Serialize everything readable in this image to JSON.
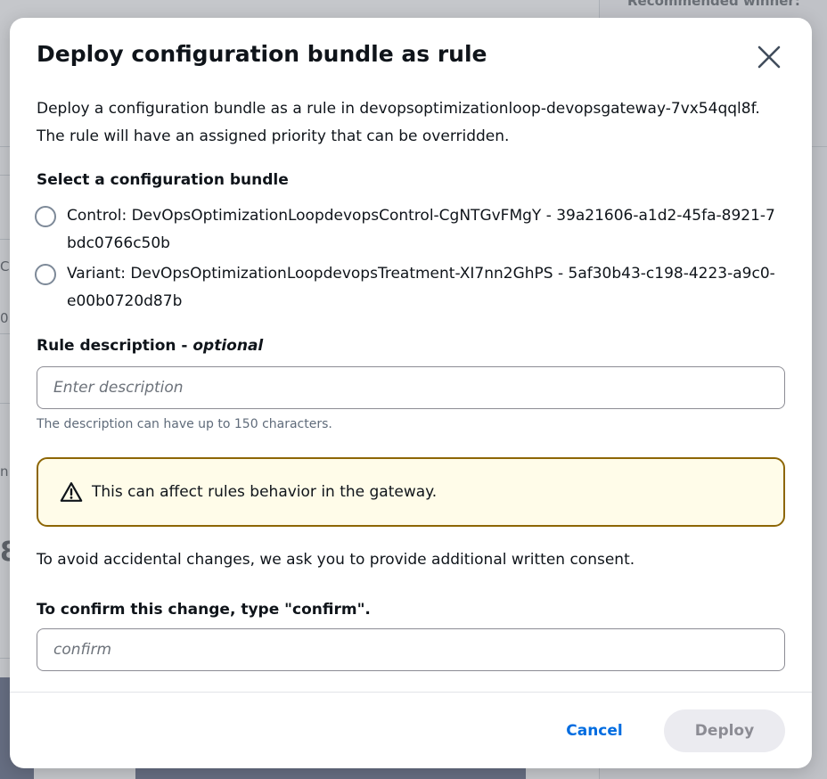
{
  "background": {
    "right_panel_heading": "Recommended winner:",
    "fragments": [
      "C",
      "0",
      "n",
      "8"
    ]
  },
  "modal": {
    "title": "Deploy configuration bundle as rule",
    "close_icon": "close-icon",
    "intro": "Deploy a configuration bundle as a rule in devopsoptimizationloop-devopsgateway-7vx54qql8f. The rule will have an assigned priority that can be overridden.",
    "bundle_section": {
      "label": "Select a configuration bundle",
      "options": [
        {
          "label": "Control: DevOpsOptimizationLoopdevopsControl-CgNTGvFMgY - 39a21606-a1d2-45fa-8921-7bdc0766c50b",
          "selected": false
        },
        {
          "label": "Variant: DevOpsOptimizationLoopdevopsTreatment-XI7nn2GhPS - 5af30b43-c198-4223-a9c0-e00b0720d87b",
          "selected": false
        }
      ]
    },
    "description": {
      "label": "Rule description - ",
      "label_optional": "optional",
      "placeholder": "Enter description",
      "value": "",
      "hint": "The description can have up to 150 characters."
    },
    "warning": {
      "icon": "warning-icon",
      "text": "This can affect rules behavior in the gateway.",
      "border_color": "#8d6605",
      "background_color": "#fffce9"
    },
    "consent_text": "To avoid accidental changes, we ask you to provide additional written consent.",
    "confirm": {
      "label": "To confirm this change, type \"confirm\".",
      "placeholder": "confirm",
      "value": ""
    },
    "buttons": {
      "cancel": "Cancel",
      "deploy": "Deploy",
      "deploy_disabled": true
    },
    "colors": {
      "link_blue": "#006ce0",
      "disabled_bg": "#ebebf0",
      "disabled_text": "#8c8c94"
    }
  }
}
